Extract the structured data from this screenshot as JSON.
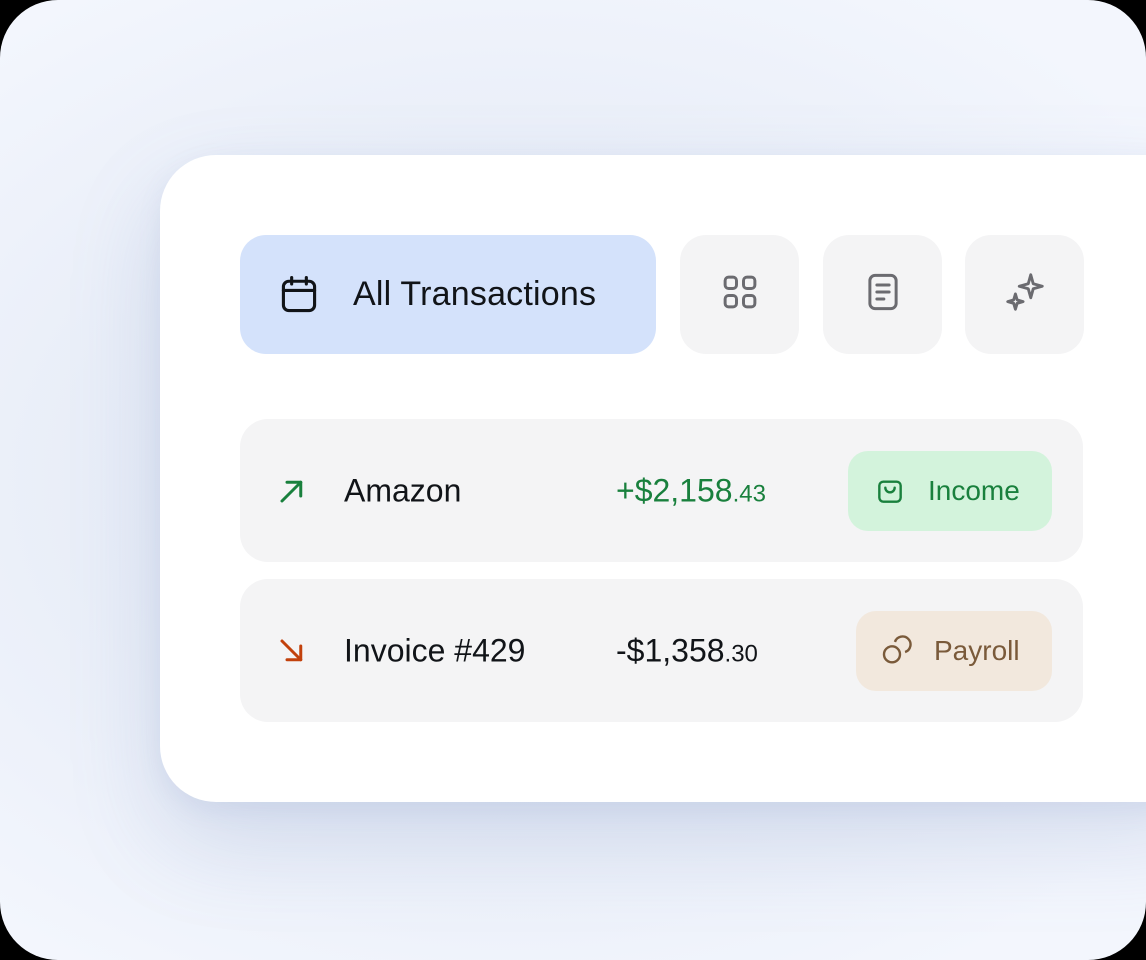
{
  "toolbar": {
    "main_tab": {
      "label": "All Transactions",
      "icon": "calendar-icon"
    },
    "icon_tabs": [
      {
        "icon": "grid-icon"
      },
      {
        "icon": "document-icon"
      },
      {
        "icon": "sparkles-icon"
      }
    ]
  },
  "transactions": [
    {
      "direction_icon": "arrow-up-right-icon",
      "direction_color": "#19803d",
      "name": "Amazon",
      "amount_main": "+$2,158",
      "amount_cents": ".43",
      "badge": {
        "label": "Income",
        "icon": "shopping-bag-icon",
        "bg": "#d3f3dc",
        "color": "#19803d"
      }
    },
    {
      "direction_icon": "arrow-down-right-icon",
      "direction_color": "#c2410c",
      "name": "Invoice #429",
      "amount_main": "-$1,358",
      "amount_cents": ".30",
      "badge": {
        "label": "Payroll",
        "icon": "coins-icon",
        "bg": "#f2e8dd",
        "color": "#7a5a3a"
      }
    }
  ]
}
